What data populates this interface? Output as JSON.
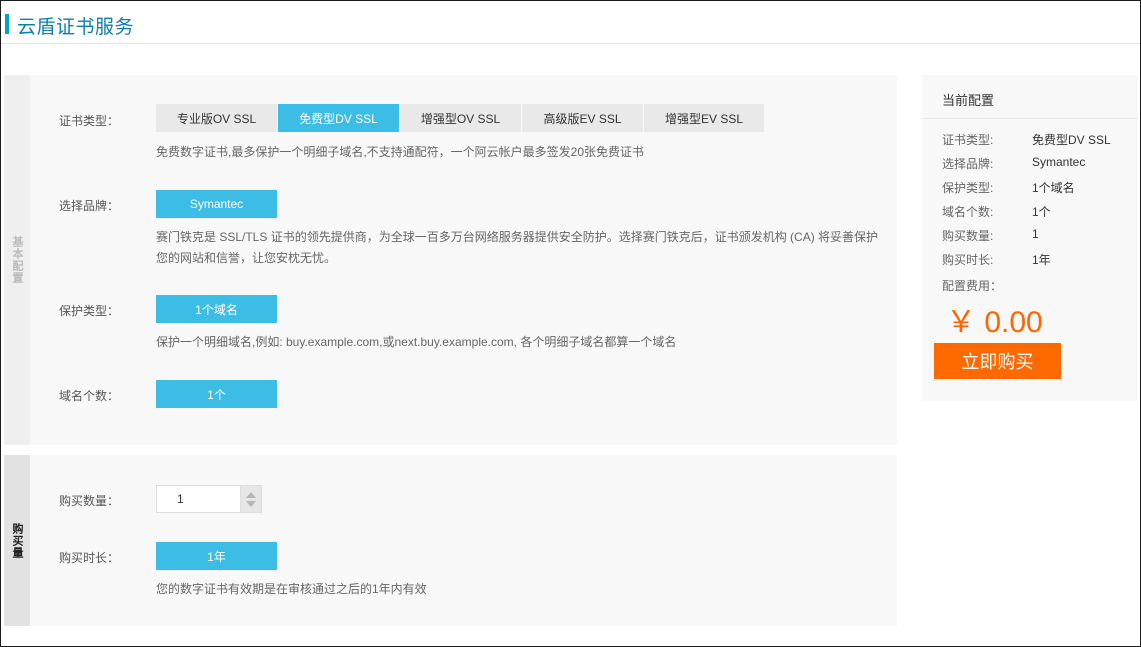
{
  "header": {
    "title": "云盾证书服务"
  },
  "sections": {
    "basic_tab": "基本配置",
    "purchase_tab": "购买量"
  },
  "cert_type": {
    "label": "证书类型：",
    "options": [
      "专业版OV SSL",
      "免费型DV SSL",
      "增强型OV SSL",
      "高级版EV SSL",
      "增强型EV SSL"
    ],
    "selected_index": 1,
    "description": "免费数字证书,最多保护一个明细子域名,不支持通配符，一个阿云帐户最多签发20张免费证书"
  },
  "brand": {
    "label": "选择品牌：",
    "value": "Symantec",
    "description_line1": "赛门铁克是 SSL/TLS 证书的领先提供商，为全球一百多万台网络服务器提供安全防护。选择赛门铁克后，证书颁发机构 (CA) 将妥善保护",
    "description_line2": "您的网站和信誉，让您安枕无忧。"
  },
  "protection": {
    "label": "保护类型：",
    "value": "1个域名",
    "description": "保护一个明细域名,例如: buy.example.com,或next.buy.example.com, 各个明细子域名都算一个域名"
  },
  "domain_count": {
    "label": "域名个数：",
    "value": "1个"
  },
  "quantity": {
    "label": "购买数量：",
    "value": "1"
  },
  "duration": {
    "label": "购买时长：",
    "value": "1年",
    "description": "您的数字证书有效期是在审核通过之后的1年内有效"
  },
  "summary": {
    "title": "当前配置",
    "rows": [
      {
        "key": "证书类型:",
        "value": "免费型DV SSL"
      },
      {
        "key": "选择品牌:",
        "value": "Symantec"
      },
      {
        "key": "保护类型:",
        "value": "1个域名"
      },
      {
        "key": "域名个数:",
        "value": "1个"
      },
      {
        "key": "购买数量:",
        "value": "1"
      },
      {
        "key": "购买时长:",
        "value": "1年"
      }
    ],
    "fee_label": "配置费用：",
    "price": "￥ 0.00",
    "buy_label": "立即购买"
  },
  "colors": {
    "accent_blue": "#3cbde5",
    "title_blue": "#0d7eb1",
    "price_orange": "#ff6600",
    "button_orange": "#ff6a00"
  }
}
